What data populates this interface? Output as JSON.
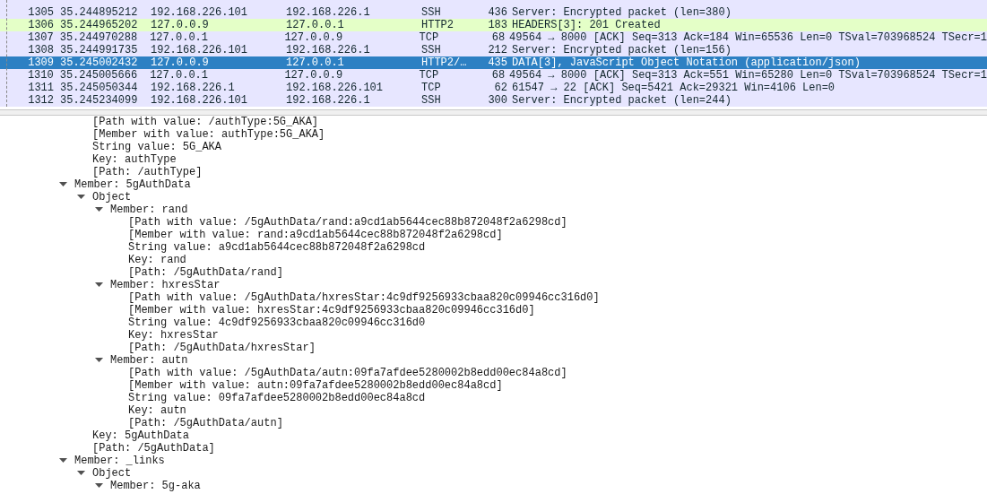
{
  "packet_list": {
    "rows": [
      {
        "no": "1305",
        "time": "35.244895212",
        "source": "192.168.226.101",
        "destination": "192.168.226.1",
        "protocol": "SSH",
        "length": "436",
        "info": "Server: Encrypted packet (len=380)",
        "color": "#e7e6ff",
        "selected": false
      },
      {
        "no": "1306",
        "time": "35.244965202",
        "source": "127.0.0.9",
        "destination": "127.0.0.1",
        "protocol": "HTTP2",
        "length": "183",
        "info": "HEADERS[3]: 201 Created",
        "color": "#e4ffc7",
        "selected": false
      },
      {
        "no": "1307",
        "time": "35.244970288",
        "source": "127.0.0.1",
        "destination": "127.0.0.9",
        "protocol": "TCP",
        "length": "68",
        "info": "49564 → 8000 [ACK] Seq=313 Ack=184 Win=65536 Len=0 TSval=703968524 TSecr=1",
        "color": "#e7e6ff",
        "selected": false
      },
      {
        "no": "1308",
        "time": "35.244991735",
        "source": "192.168.226.101",
        "destination": "192.168.226.1",
        "protocol": "SSH",
        "length": "212",
        "info": "Server: Encrypted packet (len=156)",
        "color": "#e7e6ff",
        "selected": false
      },
      {
        "no": "1309",
        "time": "35.245002432",
        "source": "127.0.0.9",
        "destination": "127.0.0.1",
        "protocol": "HTTP2/…",
        "length": "435",
        "info": "DATA[3], JavaScript Object Notation (application/json)",
        "selected": true
      },
      {
        "no": "1310",
        "time": "35.245005666",
        "source": "127.0.0.1",
        "destination": "127.0.0.9",
        "protocol": "TCP",
        "length": "68",
        "info": "49564 → 8000 [ACK] Seq=313 Ack=551 Win=65280 Len=0 TSval=703968524 TSecr=1",
        "color": "#e7e6ff",
        "selected": false
      },
      {
        "no": "1311",
        "time": "35.245050344",
        "source": "192.168.226.1",
        "destination": "192.168.226.101",
        "protocol": "TCP",
        "length": "62",
        "info": "61547 → 22 [ACK] Seq=5421 Ack=29321 Win=4106 Len=0",
        "color": "#e7e6ff",
        "selected": false
      },
      {
        "no": "1312",
        "time": "35.245234099",
        "source": "192.168.226.101",
        "destination": "192.168.226.1",
        "protocol": "SSH",
        "length": "300",
        "info": "Server: Encrypted packet (len=244)",
        "color": "#e7e6ff",
        "selected": false
      }
    ]
  },
  "details_tree": [
    {
      "children": [
        {
          "label": "[Path with value: /authType:5G_AKA]"
        },
        {
          "label": "[Member with value: authType:5G_AKA]"
        },
        {
          "label": "String value: 5G_AKA"
        },
        {
          "label": "Key: authType"
        },
        {
          "label": "[Path: /authType]"
        }
      ]
    },
    {
      "label": "Member: 5gAuthData",
      "expanded": true,
      "children": [
        {
          "label": "Object",
          "expanded": true,
          "children": [
            {
              "label": "Member: rand",
              "expanded": true,
              "children": [
                {
                  "label": "[Path with value: /5gAuthData/rand:a9cd1ab5644cec88b872048f2a6298cd]"
                },
                {
                  "label": "[Member with value: rand:a9cd1ab5644cec88b872048f2a6298cd]"
                },
                {
                  "label": "String value: a9cd1ab5644cec88b872048f2a6298cd"
                },
                {
                  "label": "Key: rand"
                },
                {
                  "label": "[Path: /5gAuthData/rand]"
                }
              ]
            },
            {
              "label": "Member: hxresStar",
              "expanded": true,
              "children": [
                {
                  "label": "[Path with value: /5gAuthData/hxresStar:4c9df9256933cbaa820c09946cc316d0]"
                },
                {
                  "label": "[Member with value: hxresStar:4c9df9256933cbaa820c09946cc316d0]"
                },
                {
                  "label": "String value: 4c9df9256933cbaa820c09946cc316d0"
                },
                {
                  "label": "Key: hxresStar"
                },
                {
                  "label": "[Path: /5gAuthData/hxresStar]"
                }
              ]
            },
            {
              "label": "Member: autn",
              "expanded": true,
              "children": [
                {
                  "label": "[Path with value: /5gAuthData/autn:09fa7afdee5280002b8edd00ec84a8cd]"
                },
                {
                  "label": "[Member with value: autn:09fa7afdee5280002b8edd00ec84a8cd]"
                },
                {
                  "label": "String value: 09fa7afdee5280002b8edd00ec84a8cd"
                },
                {
                  "label": "Key: autn"
                },
                {
                  "label": "[Path: /5gAuthData/autn]"
                }
              ]
            }
          ]
        },
        {
          "label": "Key: 5gAuthData"
        },
        {
          "label": "[Path: /5gAuthData]"
        }
      ]
    },
    {
      "label": "Member: _links",
      "expanded": true,
      "children": [
        {
          "label": "Object",
          "expanded": true,
          "children": [
            {
              "label": "Member: 5g-aka",
              "expanded": true
            }
          ]
        }
      ]
    }
  ]
}
